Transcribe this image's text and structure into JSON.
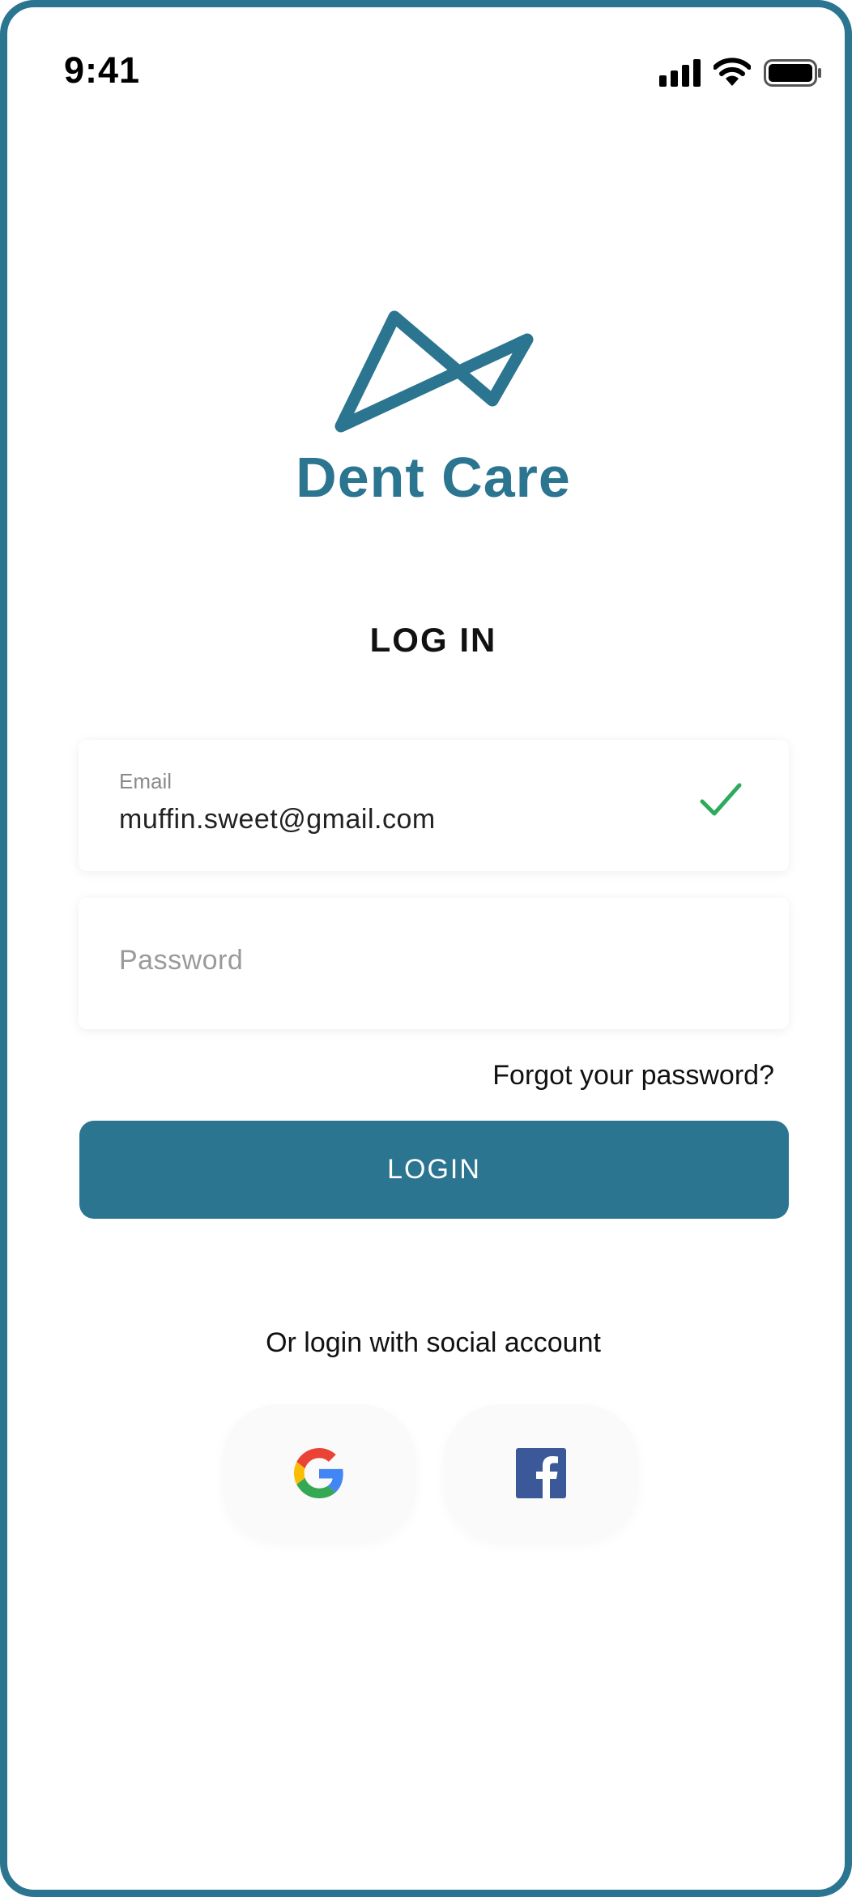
{
  "status_bar": {
    "time": "9:41",
    "icons": [
      "signal-icon",
      "wifi-icon",
      "battery-icon"
    ]
  },
  "brand": {
    "name": "Dent Care",
    "logo_icon": "dent-care-logo-icon",
    "color": "#2b7590"
  },
  "page": {
    "title": "LOG IN"
  },
  "email_field": {
    "label": "Email",
    "value": "muffin.sweet@gmail.com",
    "status_icon": "check-icon",
    "status_color": "#2eaa5c"
  },
  "password_field": {
    "placeholder": "Password",
    "value": ""
  },
  "forgot_password": {
    "label": "Forgot your password?"
  },
  "login_button": {
    "label": "LOGIN",
    "color": "#2b7590"
  },
  "social": {
    "caption": "Or login with social account",
    "providers": [
      {
        "name": "google",
        "icon": "google-icon"
      },
      {
        "name": "facebook",
        "icon": "facebook-icon"
      }
    ]
  }
}
